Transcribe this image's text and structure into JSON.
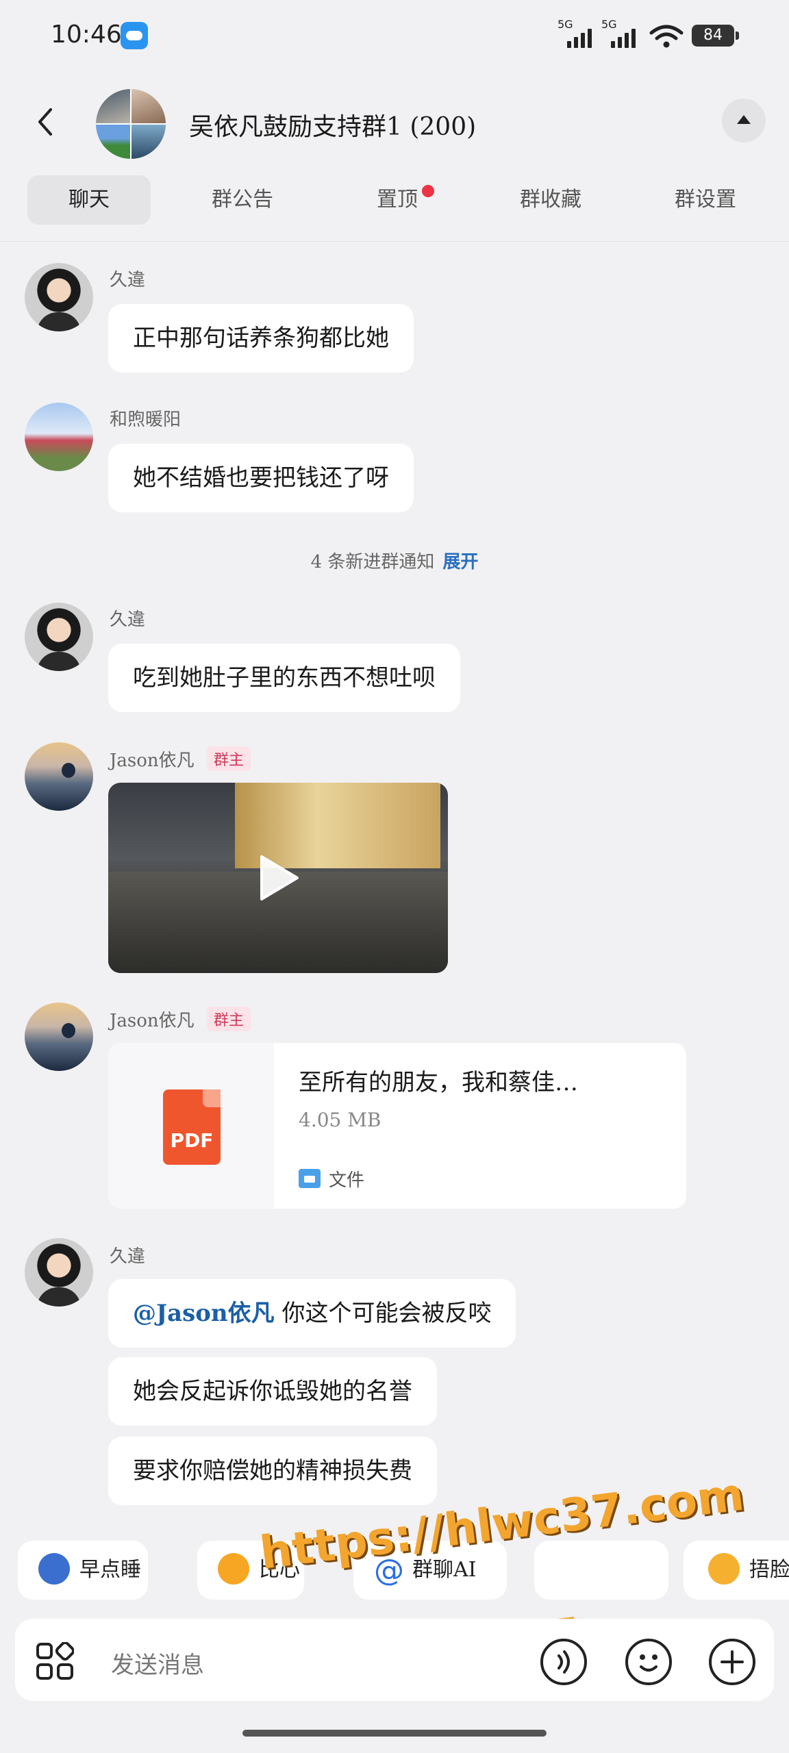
{
  "status_bar": {
    "time": "10:46",
    "net1": "5G",
    "net2": "5G",
    "battery": "84"
  },
  "header": {
    "title": "吴依凡鼓励支持群1 (200)"
  },
  "tabs": [
    {
      "label": "聊天",
      "active": true
    },
    {
      "label": "群公告"
    },
    {
      "label": "置顶",
      "has_dot": true
    },
    {
      "label": "群收藏"
    },
    {
      "label": "群设置"
    }
  ],
  "messages": [
    {
      "sender": "久違",
      "text": "正中那句话养条狗都比她"
    },
    {
      "sender": "和煦暖阳",
      "text": "她不结婚也要把钱还了呀"
    },
    {
      "sender": "久違",
      "text": "吃到她肚子里的东西不想吐呗"
    },
    {
      "sender": "Jason依凡",
      "badge": "群主",
      "type": "video"
    },
    {
      "sender": "Jason依凡",
      "badge": "群主",
      "type": "file",
      "file": {
        "name": "至所有的朋友，我和蔡佳…",
        "size": "4.05 MB",
        "kind": "文件",
        "icon_label": "PDF"
      }
    },
    {
      "sender": "久違",
      "mention": "@Jason依凡",
      "text": " 你这个可能会被反咬",
      "text2": "她会反起诉你诋毁她的名誉",
      "text3": "要求你赔偿她的精神损失费"
    }
  ],
  "notice": {
    "text": "4 条新进群通知",
    "action": "展开"
  },
  "quick_chips": [
    {
      "label": "早点睡",
      "icon": "sleep-emoji-icon"
    },
    {
      "label": "比心",
      "icon": "heart-hands-emoji-icon"
    },
    {
      "label": "群聊AI",
      "icon": "at-icon"
    },
    {
      "label": "",
      "icon": "blank"
    },
    {
      "label": "捂脸",
      "icon": "facepalm-emoji-icon"
    }
  ],
  "input": {
    "placeholder": "发送消息"
  },
  "watermark": {
    "line1": "https://hlwc37.com",
    "line2": "黑料网"
  },
  "colors": {
    "accent": "#2a6fc0",
    "badge": "#d03a5a",
    "background": "#f1f1f3"
  }
}
